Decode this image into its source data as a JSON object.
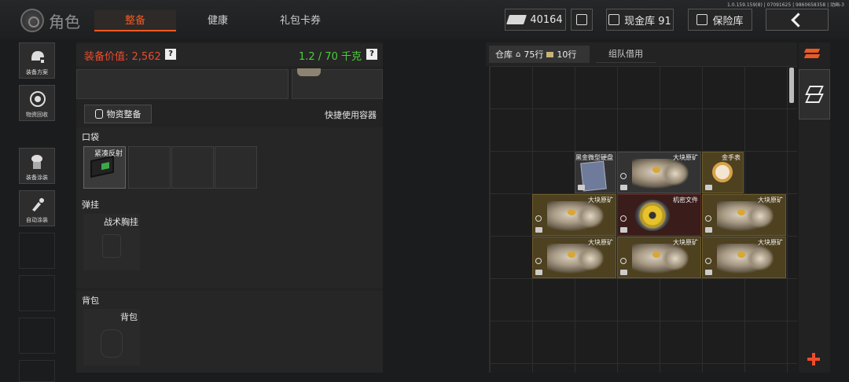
{
  "version": "1.0.159.159(8) | 07091625 | 9860658358 | 动画-3",
  "title": "角色",
  "tabs": [
    {
      "label": "整备",
      "active": true
    },
    {
      "label": "健康",
      "active": false
    },
    {
      "label": "礼包卡券",
      "active": false
    }
  ],
  "header": {
    "currency": "40164",
    "cash_vault": "现金库 91",
    "safe": "保险库"
  },
  "rail": [
    {
      "label": "装备方案",
      "icon": "helmet-icon"
    },
    {
      "label": "物资回收",
      "icon": "recycle-icon"
    },
    {
      "label": "装备涂装",
      "icon": "soldier-icon"
    },
    {
      "label": "自动涂装",
      "icon": "brush-icon"
    }
  ],
  "equipment": {
    "value_label": "装备价值: 2,562",
    "weight_label": "1.2 / 70 千克",
    "help": "?",
    "supply_button": "物资整备",
    "quick_use": "快捷使用容器",
    "pocket_title": "口袋",
    "pocket_item": "紧凑反射",
    "rig_title": "弹挂",
    "rig_slot": "战术胸挂",
    "backpack_title": "背包",
    "backpack_slot": "背包"
  },
  "warehouse": {
    "tab_label": "仓库",
    "rows_a": "75行",
    "rows_b": "10行",
    "team_tab": "组队借用",
    "items": [
      {
        "name": "黑金微型硬盘",
        "type": "plain",
        "col": 2,
        "row": 2,
        "w": 1
      },
      {
        "name": "大块原矿",
        "type": "plain",
        "col": 3,
        "row": 2,
        "w": 2
      },
      {
        "name": "金手表",
        "type": "gold",
        "col": 5,
        "row": 2,
        "w": 1
      },
      {
        "name": "大块原矿",
        "type": "gold",
        "col": 1,
        "row": 3,
        "w": 2
      },
      {
        "name": "机密文件",
        "type": "red",
        "col": 3,
        "row": 3,
        "w": 2
      },
      {
        "name": "大块原矿",
        "type": "gold",
        "col": 5,
        "row": 3,
        "w": 2
      },
      {
        "name": "大块原矿",
        "type": "gold",
        "col": 1,
        "row": 4,
        "w": 2
      },
      {
        "name": "大块原矿",
        "type": "gold",
        "col": 3,
        "row": 4,
        "w": 2
      },
      {
        "name": "大块原矿",
        "type": "gold",
        "col": 5,
        "row": 4,
        "w": 2
      }
    ]
  },
  "colors": {
    "accent": "#ee5a24",
    "value_red": "#ee4b2b",
    "weight_green": "#4cd03a",
    "gold_bg": "#4e4120"
  }
}
